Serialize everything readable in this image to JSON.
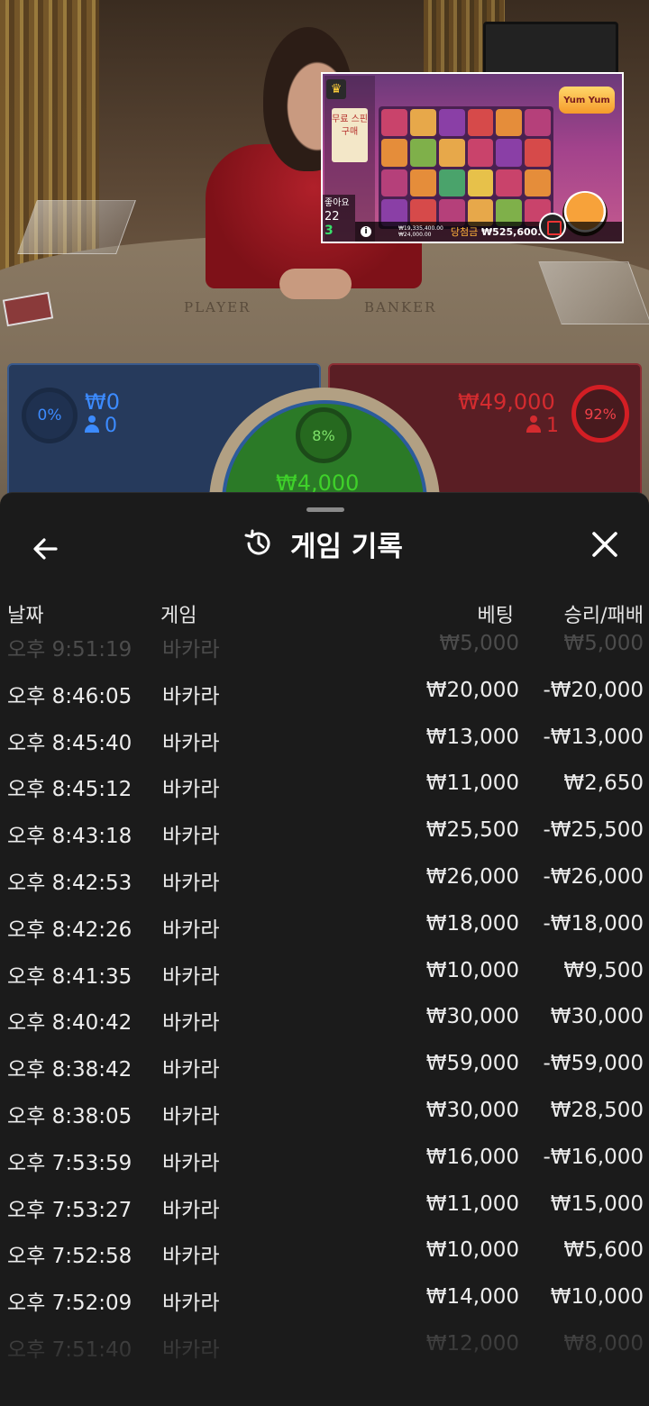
{
  "video": {
    "felt_player": "PLAYER",
    "felt_banker": "BANKER",
    "slot": {
      "logo": "Yum Yum",
      "sign": "무료 스핀 구매",
      "likes_label": "좋아요",
      "likes_count": "22",
      "green_count": "3",
      "small_line1": "₩19,335,400.00",
      "small_line2": "₩24,000.00",
      "win_label": "당첨금",
      "win_amount": "₩525,600.00",
      "trophy_icon": "trophy-icon"
    }
  },
  "bets": {
    "player": {
      "percent": "0%",
      "amount": "₩0",
      "count": "0"
    },
    "tie": {
      "percent": "8%",
      "amount": "₩4,000"
    },
    "banker": {
      "percent": "92%",
      "amount": "₩49,000",
      "count": "1"
    }
  },
  "sheet": {
    "title": "게임 기록",
    "back_icon": "arrow-left-icon",
    "history_icon": "history-icon",
    "close_icon": "close-icon",
    "columns": {
      "date": "날짜",
      "game": "게임",
      "bet": "베팅",
      "winloss": "승리/패배"
    },
    "rows": [
      {
        "date": "오후 9:51:19",
        "game": "바카라",
        "bet": "₩5,000",
        "winloss": "₩5,000"
      },
      {
        "date": "오후 8:46:05",
        "game": "바카라",
        "bet": "₩20,000",
        "winloss": "-₩20,000"
      },
      {
        "date": "오후 8:45:40",
        "game": "바카라",
        "bet": "₩13,000",
        "winloss": "-₩13,000"
      },
      {
        "date": "오후 8:45:12",
        "game": "바카라",
        "bet": "₩11,000",
        "winloss": "₩2,650"
      },
      {
        "date": "오후 8:43:18",
        "game": "바카라",
        "bet": "₩25,500",
        "winloss": "-₩25,500"
      },
      {
        "date": "오후 8:42:53",
        "game": "바카라",
        "bet": "₩26,000",
        "winloss": "-₩26,000"
      },
      {
        "date": "오후 8:42:26",
        "game": "바카라",
        "bet": "₩18,000",
        "winloss": "-₩18,000"
      },
      {
        "date": "오후 8:41:35",
        "game": "바카라",
        "bet": "₩10,000",
        "winloss": "₩9,500"
      },
      {
        "date": "오후 8:40:42",
        "game": "바카라",
        "bet": "₩30,000",
        "winloss": "₩30,000"
      },
      {
        "date": "오후 8:38:42",
        "game": "바카라",
        "bet": "₩59,000",
        "winloss": "-₩59,000"
      },
      {
        "date": "오후 8:38:05",
        "game": "바카라",
        "bet": "₩30,000",
        "winloss": "₩28,500"
      },
      {
        "date": "오후 7:53:59",
        "game": "바카라",
        "bet": "₩16,000",
        "winloss": "-₩16,000"
      },
      {
        "date": "오후 7:53:27",
        "game": "바카라",
        "bet": "₩11,000",
        "winloss": "₩15,000"
      },
      {
        "date": "오후 7:52:58",
        "game": "바카라",
        "bet": "₩10,000",
        "winloss": "₩5,600"
      },
      {
        "date": "오후 7:52:09",
        "game": "바카라",
        "bet": "₩14,000",
        "winloss": "₩10,000"
      },
      {
        "date": "오후 7:51:40",
        "game": "바카라",
        "bet": "₩12,000",
        "winloss": "₩8,000"
      }
    ]
  }
}
